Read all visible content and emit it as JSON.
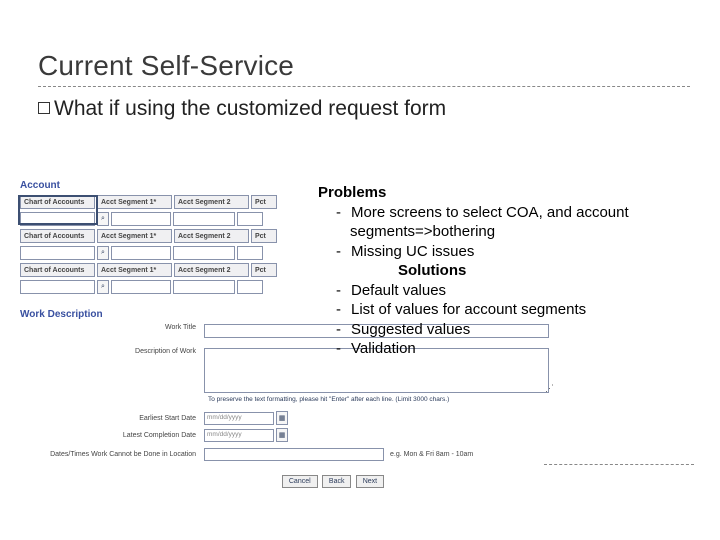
{
  "title": "Current Self-Service",
  "subtitle_prefix": "What",
  "subtitle_rest": " if using the customized request form",
  "form": {
    "account_label": "Account",
    "headers": {
      "coa": "Chart of Accounts",
      "seg1": "Acct Segment 1*",
      "seg2": "Acct Segment 2",
      "pct": "Pct"
    },
    "work_desc_label": "Work Description",
    "work_title_label": "Work Title",
    "desc_label": "Description of Work",
    "note": "To preserve the text formatting, please hit \"Enter\" after each line. (Limit 3000 chars.)",
    "earliest": "Earliest Start Date",
    "latest": "Latest Completion Date",
    "date_ph": "mm/dd/yyyy",
    "times_label": "Dates/Times Work Cannot be Done in Location",
    "times_hint": "e.g. Mon & Fri 8am - 10am",
    "buttons": {
      "cancel": "Cancel",
      "back": "Back",
      "next": "Next"
    }
  },
  "overlay": {
    "problems_hdr": "Problems",
    "problems": [
      "More screens to select COA, and account segments=>bothering",
      "Missing UC issues"
    ],
    "solutions_hdr": "Solutions",
    "solutions": [
      "Default values",
      "List of values for account segments",
      "Suggested values",
      "Validation"
    ]
  }
}
